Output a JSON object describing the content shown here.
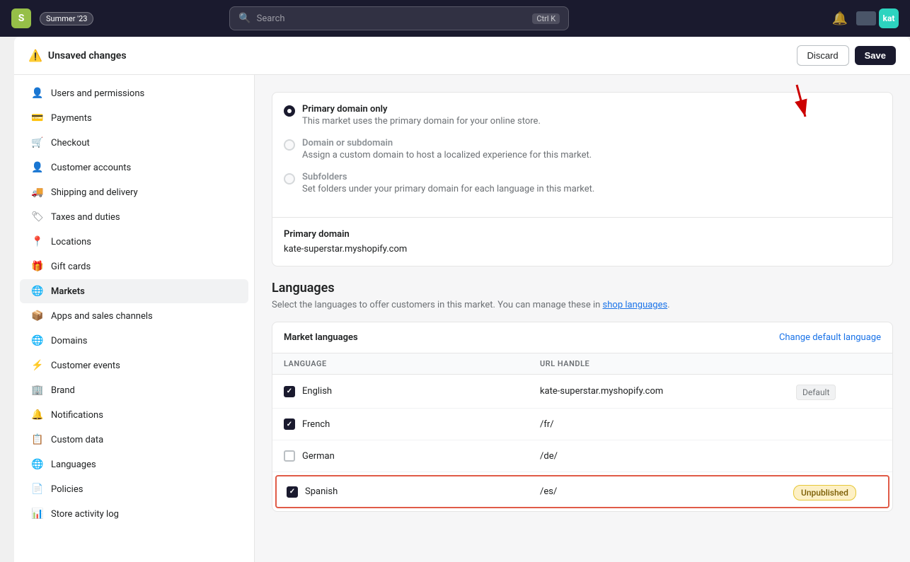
{
  "topbar": {
    "logo_letter": "S",
    "badge": "Summer '23",
    "search_placeholder": "Search",
    "shortcut": "Ctrl K",
    "avatar_initials": "kat"
  },
  "unsaved_bar": {
    "title": "Unsaved changes",
    "discard_label": "Discard",
    "save_label": "Save"
  },
  "sidebar": {
    "items": [
      {
        "id": "users",
        "label": "Users and permissions",
        "icon": "👤"
      },
      {
        "id": "payments",
        "label": "Payments",
        "icon": "💳"
      },
      {
        "id": "checkout",
        "label": "Checkout",
        "icon": "🛒"
      },
      {
        "id": "customer-accounts",
        "label": "Customer accounts",
        "icon": "👤"
      },
      {
        "id": "shipping",
        "label": "Shipping and delivery",
        "icon": "🚚"
      },
      {
        "id": "taxes",
        "label": "Taxes and duties",
        "icon": "🏷"
      },
      {
        "id": "locations",
        "label": "Locations",
        "icon": "📍"
      },
      {
        "id": "gift-cards",
        "label": "Gift cards",
        "icon": "🎁"
      },
      {
        "id": "markets",
        "label": "Markets",
        "icon": "🌐",
        "active": true
      },
      {
        "id": "apps",
        "label": "Apps and sales channels",
        "icon": "📦"
      },
      {
        "id": "domains",
        "label": "Domains",
        "icon": "🌐"
      },
      {
        "id": "customer-events",
        "label": "Customer events",
        "icon": "⚡"
      },
      {
        "id": "brand",
        "label": "Brand",
        "icon": "🏢"
      },
      {
        "id": "notifications",
        "label": "Notifications",
        "icon": "🔔"
      },
      {
        "id": "custom-data",
        "label": "Custom data",
        "icon": "📋"
      },
      {
        "id": "languages",
        "label": "Languages",
        "icon": "🌐"
      },
      {
        "id": "policies",
        "label": "Policies",
        "icon": "📄"
      },
      {
        "id": "store-activity",
        "label": "Store activity log",
        "icon": "📊"
      }
    ]
  },
  "domain_section": {
    "options": [
      {
        "id": "primary-only",
        "label": "Primary domain only",
        "description": "This market uses the primary domain for your online store.",
        "selected": true,
        "disabled": false
      },
      {
        "id": "domain-subdomain",
        "label": "Domain or subdomain",
        "description": "Assign a custom domain to host a localized experience for this market.",
        "selected": false,
        "disabled": true
      },
      {
        "id": "subfolders",
        "label": "Subfolders",
        "description": "Set folders under your primary domain for each language in this market.",
        "selected": false,
        "disabled": true
      }
    ],
    "primary_domain_label": "Primary domain",
    "primary_domain_value": "kate-superstar.myshopify.com"
  },
  "languages_section": {
    "title": "Languages",
    "description": "Select the languages to offer customers in this market. You can manage these in",
    "link_text": "shop languages",
    "link_suffix": ".",
    "market_languages_label": "Market languages",
    "change_default_label": "Change default language",
    "col_language": "LANGUAGE",
    "col_url_handle": "URL HANDLE",
    "languages": [
      {
        "name": "English",
        "checked": true,
        "url_handle": "kate-superstar.myshopify.com",
        "badge": "Default",
        "badge_type": "default",
        "highlighted": false
      },
      {
        "name": "French",
        "checked": true,
        "url_handle": "/fr/",
        "badge": "",
        "badge_type": "none",
        "highlighted": false
      },
      {
        "name": "German",
        "checked": false,
        "url_handle": "/de/",
        "badge": "",
        "badge_type": "none",
        "highlighted": false
      },
      {
        "name": "Spanish",
        "checked": true,
        "url_handle": "/es/",
        "badge": "Unpublished",
        "badge_type": "unpublished",
        "highlighted": true
      }
    ]
  }
}
